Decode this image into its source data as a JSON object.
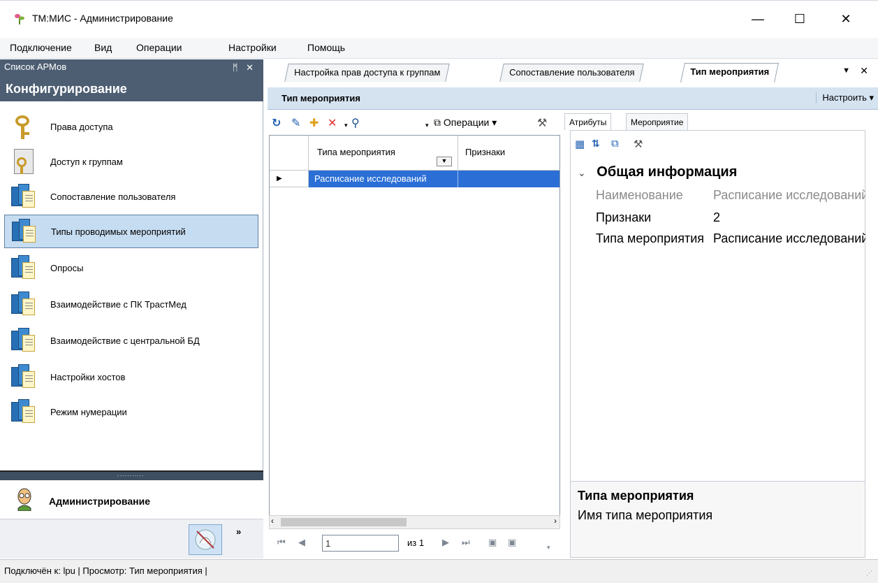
{
  "window": {
    "title": "ТМ:МИС - Администрирование",
    "minimize": "—",
    "maximize": "☐",
    "close": "✕"
  },
  "menu": {
    "items": [
      "Подключение",
      "Вид",
      "Операции",
      "Настройки",
      "Помощь"
    ]
  },
  "left_panel": {
    "header": "Список АРМов",
    "pin": "ᛗ ✕",
    "group_title": "Конфигурирование",
    "items": [
      {
        "label": "Права доступа",
        "icon": "keys-icon"
      },
      {
        "label": "Доступ к группам",
        "icon": "door-key-icon"
      },
      {
        "label": "Сопоставление пользователя",
        "icon": "folders-icon"
      },
      {
        "label": "Типы проводимых мероприятий",
        "icon": "folders-icon",
        "selected": true
      },
      {
        "label": "Опросы",
        "icon": "folders-icon"
      },
      {
        "label": "Взаимодействие с ПК ТрастМед",
        "icon": "folders-icon"
      },
      {
        "label": "Взаимодействие с центральной БД",
        "icon": "folders-icon"
      },
      {
        "label": "Настройки хостов",
        "icon": "folders-icon"
      },
      {
        "label": "Режим нумерации",
        "icon": "folders-icon"
      }
    ],
    "splitter_dots": "...........",
    "admin_label": "Администрирование",
    "more": "»"
  },
  "doc_tabs": [
    {
      "label": "Настройка прав доступа к группам",
      "active": false
    },
    {
      "label": "Сопоставление пользователя",
      "active": false
    },
    {
      "label": "Тип мероприятия",
      "active": true
    }
  ],
  "doc_header": {
    "title": "Тип мероприятия",
    "configure": "Настроить ▾"
  },
  "grid_toolbar": {
    "operations": "Операции ▾"
  },
  "grid": {
    "columns": [
      "Типа мероприятия",
      "Признаки"
    ],
    "rows": [
      {
        "type": "Расписание исследований",
        "flags": ""
      }
    ]
  },
  "navigator": {
    "page": "1",
    "of": "из 1"
  },
  "prop_tabs": [
    "Атрибуты",
    "Мероприятие"
  ],
  "properties": {
    "section": "Общая информация",
    "rows": [
      {
        "name": "Наименование",
        "value": "Расписание исследований",
        "disabled": true
      },
      {
        "name": "Признаки",
        "value": "2",
        "disabled": false
      },
      {
        "name": "Типа мероприятия",
        "value": "Расписание исследований",
        "disabled": false
      }
    ]
  },
  "help": {
    "title": "Типа мероприятия",
    "description": "Имя типа мероприятия"
  },
  "status": {
    "text": "Подключён к: lpu  | Просмотр: Тип мероприятия |"
  }
}
